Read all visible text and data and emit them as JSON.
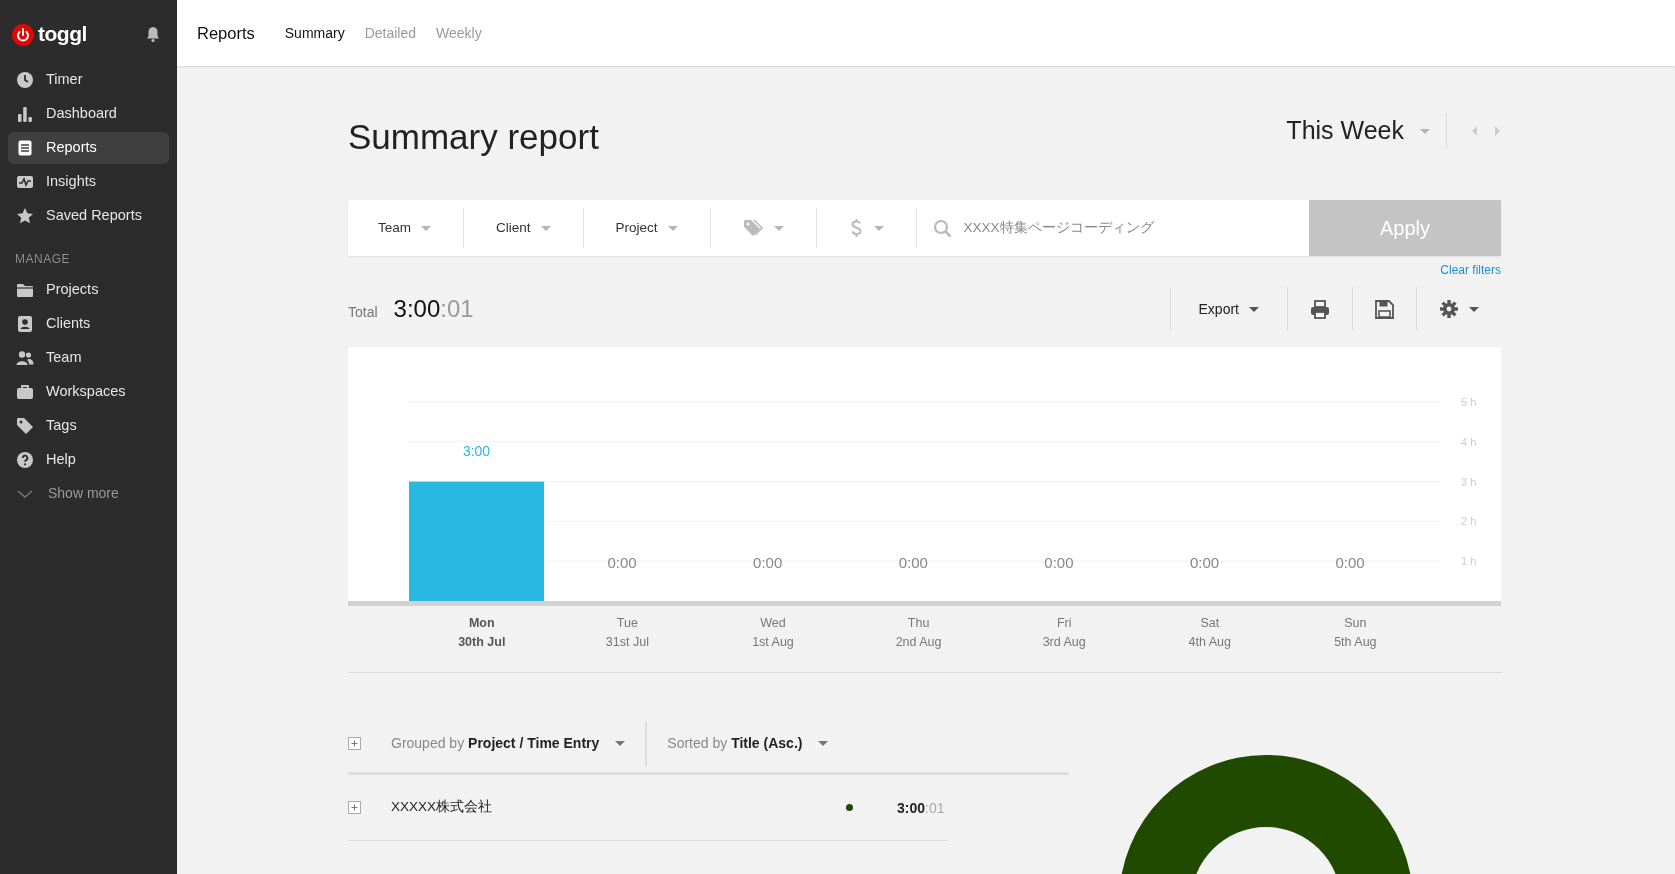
{
  "sidebar": {
    "logo": "toggl",
    "items": [
      {
        "label": "Timer",
        "selected": false
      },
      {
        "label": "Dashboard",
        "selected": false
      },
      {
        "label": "Reports",
        "selected": true
      },
      {
        "label": "Insights",
        "selected": false
      },
      {
        "label": "Saved Reports",
        "selected": false
      }
    ],
    "section_label": "MANAGE",
    "manage_items": [
      {
        "label": "Projects",
        "selected": false
      },
      {
        "label": "Clients",
        "selected": false
      },
      {
        "label": "Team",
        "selected": false
      },
      {
        "label": "Workspaces",
        "selected": false
      },
      {
        "label": "Tags",
        "selected": false
      },
      {
        "label": "Help",
        "selected": false
      }
    ],
    "show_more": "Show more"
  },
  "header": {
    "title": "Reports",
    "tabs": [
      {
        "label": "Summary",
        "selected": true
      },
      {
        "label": "Detailed",
        "selected": false
      },
      {
        "label": "Weekly",
        "selected": false
      }
    ]
  },
  "report": {
    "title": "Summary report",
    "period": "This Week",
    "filters": [
      {
        "kind": "text",
        "label": "Team"
      },
      {
        "kind": "text",
        "label": "Client"
      },
      {
        "kind": "text",
        "label": "Project"
      },
      {
        "kind": "tags"
      },
      {
        "kind": "billable"
      }
    ],
    "search": {
      "value": "XXXX特集ページコーディング"
    },
    "apply": {
      "label": "Apply",
      "disabled": true
    },
    "clear_filters": "Clear filters",
    "total": {
      "label": "Total",
      "hours_minutes": "3:00",
      "seconds": ":01"
    },
    "export": "Export"
  },
  "chart": {
    "dates": [
      "30th Jul",
      "31st Jul",
      "1st Aug",
      "2nd Aug",
      "3rd Aug",
      "4th Aug",
      "5th Aug"
    ],
    "chart_data": {
      "type": "bar",
      "categories": [
        "Mon",
        "Tue",
        "Wed",
        "Thu",
        "Fri",
        "Sat",
        "Sun"
      ],
      "series": [
        {
          "color": "#29b8e2",
          "values": [
            3.0,
            0,
            0,
            0,
            0,
            0,
            0
          ]
        }
      ],
      "grid": true,
      "ylim": [
        0,
        5
      ],
      "yticks": [
        {
          "value": 1,
          "label": "1 h"
        },
        {
          "value": 2,
          "label": "2 h"
        },
        {
          "value": 3,
          "label": "3 h"
        },
        {
          "value": 4,
          "label": "4 h"
        },
        {
          "value": 5,
          "label": "5 h"
        }
      ],
      "value_labels": [
        "3:00",
        "0:00",
        "0:00",
        "0:00",
        "0:00",
        "0:00",
        "0:00"
      ]
    }
  },
  "grouping": {
    "grouped_by": "Grouped by **Project / Time Entry**",
    "sorted_by": "Sorted by **Title (Asc.)**"
  },
  "projects": [
    {
      "name": "XXXXX株式会社",
      "color": "#1f4a00",
      "hours_minutes": "3:00",
      "seconds": ":01"
    }
  ]
}
